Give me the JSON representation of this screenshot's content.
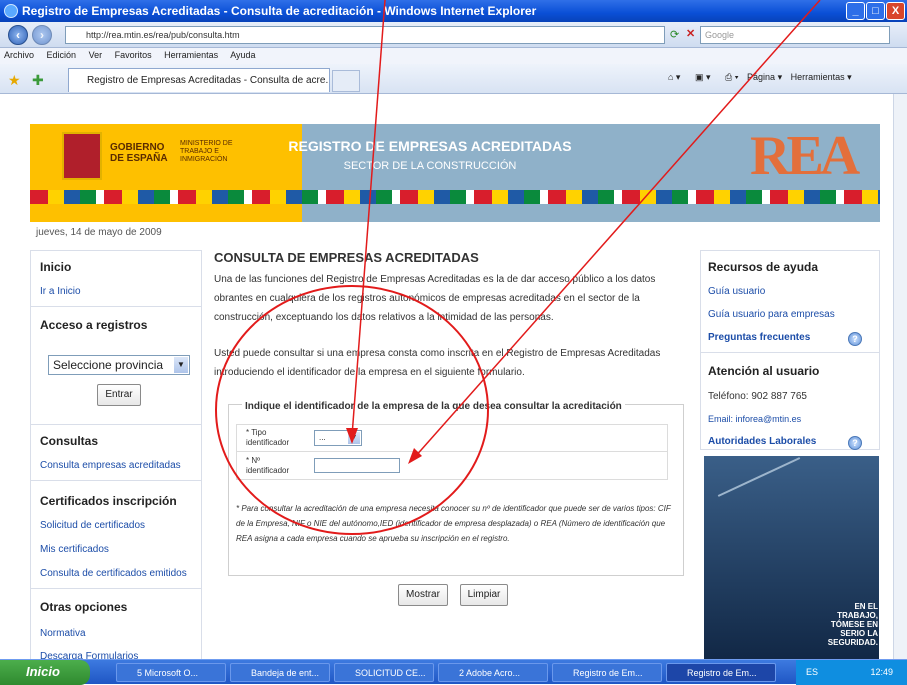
{
  "window": {
    "title": "Registro de Empresas Acreditadas - Consulta de acreditación - Windows Internet Explorer",
    "minimize": "_",
    "maximize": "□",
    "close": "X"
  },
  "browser": {
    "address": "http://rea.mtin.es/rea/pub/consulta.htm",
    "search_placeholder": "Google",
    "menu": [
      "Archivo",
      "Edición",
      "Ver",
      "Favoritos",
      "Herramientas",
      "Ayuda"
    ],
    "tab_title": "Registro de Empresas Acreditadas - Consulta de acre...",
    "page_menu": "Página",
    "tools_menu": "Herramientas"
  },
  "banner": {
    "gov": "GOBIERNO DE ESPAÑA",
    "ministry": "MINISTERIO DE TRABAJO E INMIGRACIÓN",
    "title": "REGISTRO DE EMPRESAS ACREDITADAS",
    "subtitle": "SECTOR DE LA CONSTRUCCIÓN",
    "logo": "REA"
  },
  "date": "jueves, 14 de mayo de 2009",
  "left": {
    "inicio": {
      "title": "Inicio",
      "link": "Ir a Inicio"
    },
    "acceso": {
      "title": "Acceso a registros",
      "province": "Seleccione provincia",
      "enter": "Entrar"
    },
    "consultas": {
      "title": "Consultas",
      "link": "Consulta empresas acreditadas"
    },
    "certificados": {
      "title": "Certificados inscripción",
      "links": [
        "Solicitud de certificados",
        "Mis certificados",
        "Consulta de certificados emitidos"
      ]
    },
    "otras": {
      "title": "Otras opciones",
      "links": [
        "Normativa",
        "Descarga Formularios"
      ]
    }
  },
  "main": {
    "heading": "CONSULTA DE EMPRESAS ACREDITADAS",
    "p1": "Una de las funciones del Registro de Empresas Acreditadas es la de dar acceso público a los datos obrantes en cualquiera de los registros autonómicos de empresas acreditadas en el sector de la construcción, exceptuando los datos relativos a la intimidad de las personas.",
    "p2": "Usted puede consultar si una empresa consta como inscrita en el Registro de Empresas Acreditadas introduciendo el identificador de la empresa en el siguiente formulario.",
    "legend": "Indique el identificador de la empresa de la que desea consultar la acreditación",
    "tipo_label": "* Tipo identificador",
    "tipo_value": "...",
    "n_label": "* Nº identificador",
    "footnote": "* Para consultar la acreditación de una empresa necesita conocer su nº de identificador que puede ser de varios tipos: CIF de la Empresa, NIF o NIE del autónomo,IED (identificador de empresa desplazada) o REA (Número de identificación que REA asigna a cada empresa cuando se aprueba su inscripción en el registro.",
    "show": "Mostrar",
    "clear": "Limpiar"
  },
  "right": {
    "recursos": {
      "title": "Recursos de ayuda",
      "links": [
        "Guía usuario",
        "Guía usuario para empresas",
        "Preguntas frecuentes"
      ]
    },
    "atencion": {
      "title": "Atención al usuario",
      "phone": "Teléfono: 902 887 765",
      "email": "Email: inforea@mtin.es",
      "autoridades": "Autoridades Laborales"
    },
    "promo": "EN EL TRABAJO, TÓMESE EN SERIO LA SEGURIDAD."
  },
  "taskbar": {
    "start": "Inicio",
    "tasks": [
      "5 Microsoft O...",
      "Bandeja de ent...",
      "SOLICITUD CE...",
      "2 Adobe Acro...",
      "Registro de Em...",
      "Registro de Em..."
    ],
    "lang": "ES",
    "time": "12:49"
  },
  "colors": {
    "accent": "#1c4da8",
    "annotation": "#e21b1b",
    "banner_yellow": "#fec000"
  }
}
